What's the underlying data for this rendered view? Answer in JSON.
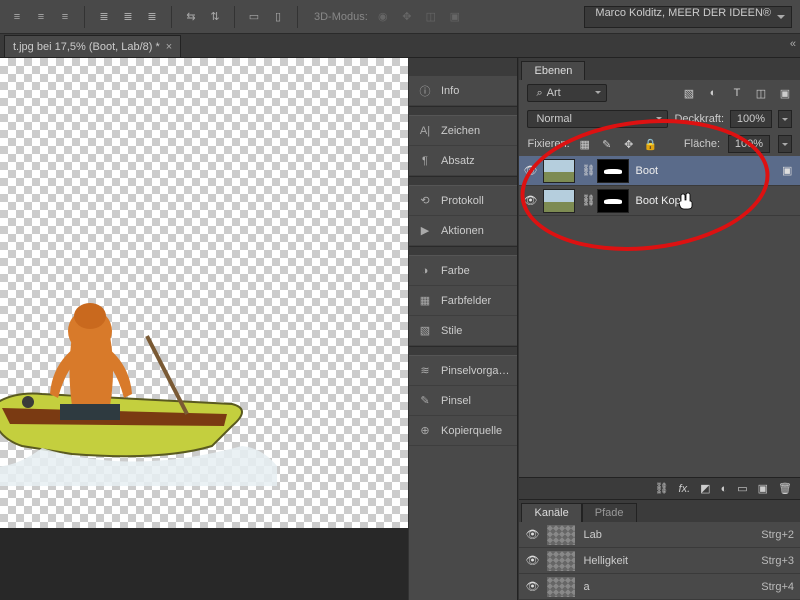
{
  "toolbar": {
    "mode3d_label": "3D-Modus:",
    "workspace": "Marco Kolditz, MEER DER IDEEN®"
  },
  "document": {
    "tab_title": "t.jpg bei 17,5% (Boot, Lab/8) *"
  },
  "side_panels": {
    "info": "Info",
    "zeichen": "Zeichen",
    "absatz": "Absatz",
    "protokoll": "Protokoll",
    "aktionen": "Aktionen",
    "farbe": "Farbe",
    "farbfelder": "Farbfelder",
    "stile": "Stile",
    "pinselvorgaben": "Pinselvorga…",
    "pinsel": "Pinsel",
    "kopierquelle": "Kopierquelle"
  },
  "layers_panel": {
    "tab": "Ebenen",
    "filter_label": "Art",
    "blend_mode": "Normal",
    "opacity_label": "Deckkraft:",
    "opacity_value": "100%",
    "lock_label": "Fixieren:",
    "fill_label": "Fläche:",
    "fill_value": "100%",
    "layers": [
      {
        "name": "Boot"
      },
      {
        "name": "Boot Kopie"
      }
    ]
  },
  "channels_panel": {
    "tab_channels": "Kanäle",
    "tab_paths": "Pfade",
    "rows": [
      {
        "name": "Lab",
        "shortcut": "Strg+2"
      },
      {
        "name": "Helligkeit",
        "shortcut": "Strg+3"
      },
      {
        "name": "a",
        "shortcut": "Strg+4"
      }
    ]
  },
  "icons": {
    "search": "⌕"
  }
}
